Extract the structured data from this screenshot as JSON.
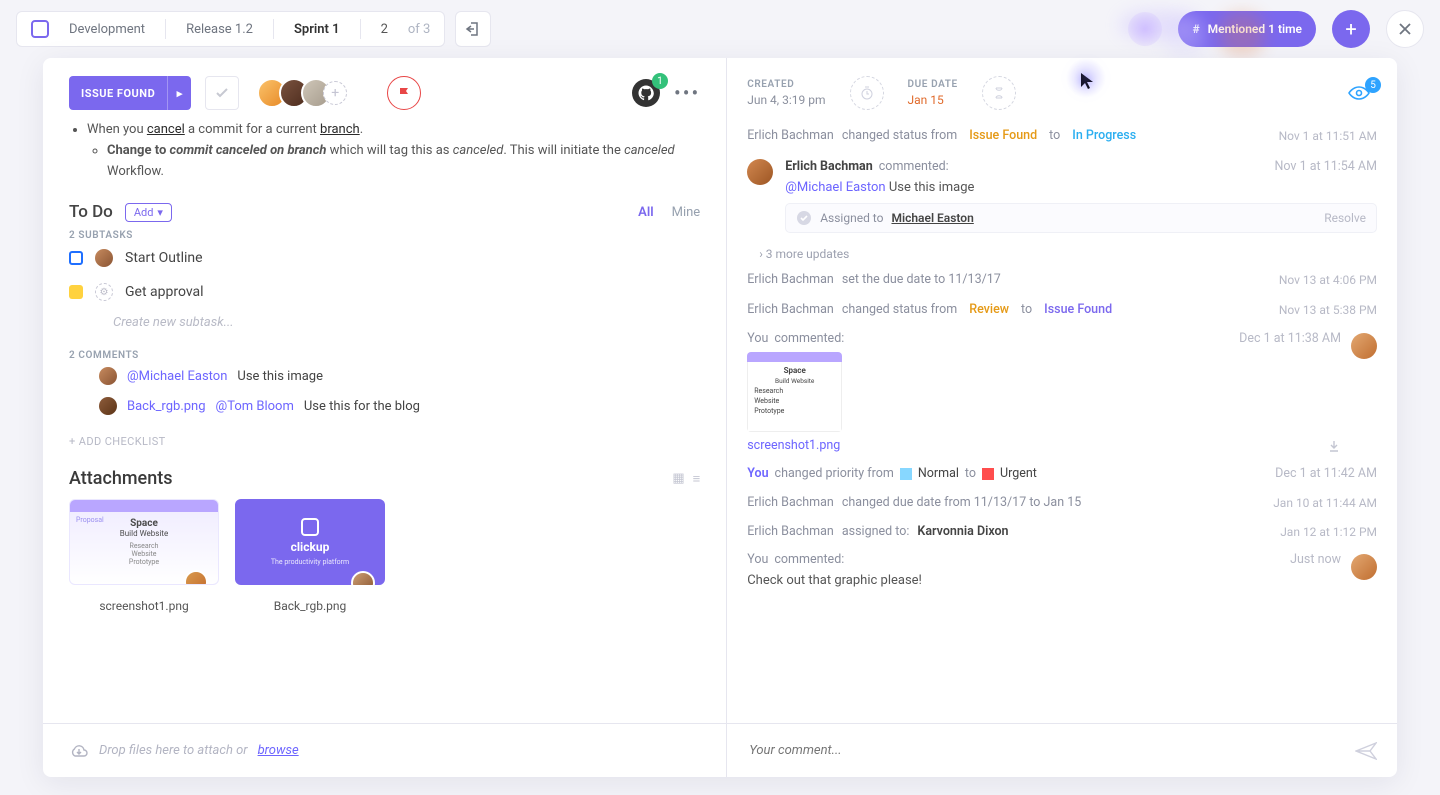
{
  "breadcrumbs": {
    "space": "Development",
    "release": "Release 1.2",
    "sprint": "Sprint 1",
    "index": "2",
    "of": "of  3"
  },
  "topbar": {
    "mentioned": "Mentioned 1 time"
  },
  "status": {
    "label": "ISSUE FOUND"
  },
  "github": {
    "badge": "1"
  },
  "meta": {
    "created_k": "CREATED",
    "created_v": "Jun 4, 3:19 pm",
    "due_k": "DUE DATE",
    "due_v": "Jan 15",
    "watchers_badge": "5"
  },
  "desc": {
    "li1_a": "When you ",
    "li1_link1": "cancel",
    "li1_b": " a commit for a current ",
    "li1_link2": "branch",
    "li1_c": ".",
    "li2_a": "Change to ",
    "li2_em": "commit canceled on branch",
    "li2_b": " which will tag this as ",
    "li2_em2": "canceled",
    "li2_c": ". This will initiate the ",
    "li2_em3": "canceled",
    "li2_d": " Workflow."
  },
  "todo": {
    "title": "To Do",
    "add": "Add",
    "tab_all": "All",
    "tab_mine": "Mine",
    "subhead": "2 SUBTASKS",
    "items": [
      {
        "label": "Start Outline"
      },
      {
        "label": "Get approval"
      }
    ],
    "new_placeholder": "Create new subtask..."
  },
  "comments": {
    "head": "2 COMMENTS",
    "rows": [
      {
        "mention": "@Michael Easton",
        "text": " Use this image"
      },
      {
        "file": "Back_rgb.png",
        "mention": "@Tom Bloom",
        "text": "Use this for the blog"
      }
    ],
    "add_checklist": "+ ADD CHECKLIST"
  },
  "attachments": {
    "title": "Attachments",
    "items": [
      {
        "name": "screenshot1.png"
      },
      {
        "name": "Back_rgb.png"
      }
    ],
    "thumb1": {
      "h": "Space",
      "sub": "Build Website",
      "lines": [
        "Research",
        "Website",
        "Prototype"
      ],
      "side": "Proposal"
    },
    "thumb2": {
      "brand": "clickup",
      "tag": "The productivity platform"
    }
  },
  "drop": {
    "text": "Drop files here to attach or ",
    "browse": "browse"
  },
  "activity": {
    "row_status1": {
      "who": "Erlich Bachman",
      "verb": " changed status from ",
      "from": "Issue Found",
      "to_lbl": " to ",
      "to": "In Progress",
      "ts": "Nov 1 at 11:51 AM"
    },
    "erlich_comment": {
      "name": "Erlich Bachman",
      "verb": " commented:",
      "ts": "Nov 1 at 11:54 AM",
      "mention": "@Michael Easton",
      "text": " Use this image",
      "assigned_lbl": "Assigned to ",
      "assigned_name": "Michael Easton",
      "resolve": "Resolve"
    },
    "more": "› 3 more updates",
    "row_due": {
      "who": "Erlich Bachman",
      "verb": " set the due date to 11/13/17",
      "ts": "Nov 13 at 4:06 PM"
    },
    "row_status2": {
      "who": "Erlich Bachman",
      "verb": " changed status from ",
      "from": "Review",
      "to_lbl": " to ",
      "to": "Issue Found",
      "ts": "Nov 13 at 5:38 PM"
    },
    "you_comment1": {
      "you": "You",
      "verb": " commented:",
      "ts": "Dec 1 at 11:38 AM",
      "img_name": "screenshot1.png",
      "thumb": {
        "h": "Space",
        "sub": "Build Website",
        "l1": "Research",
        "l2": "Website",
        "l3": "Prototype"
      }
    },
    "row_prio": {
      "you": "You",
      "verb": " changed priority from ",
      "from": "Normal",
      "to_lbl": " to ",
      "to": "Urgent",
      "ts": "Dec 1 at 11:42 AM"
    },
    "row_due2": {
      "who": "Erlich Bachman",
      "verb": " changed due date from 11/13/17 to Jan 15",
      "ts": "Jan 10 at 11:44 AM"
    },
    "row_assign": {
      "who": "Erlich Bachman",
      "verb": " assigned to: ",
      "name": "Karvonnia Dixon",
      "ts": "Jan 12 at 1:12 PM"
    },
    "you_comment2": {
      "you": "You",
      "verb": " commented:",
      "ts": "Just now",
      "text": "Check out that graphic please!"
    }
  },
  "comment_input": {
    "placeholder": "Your comment..."
  }
}
